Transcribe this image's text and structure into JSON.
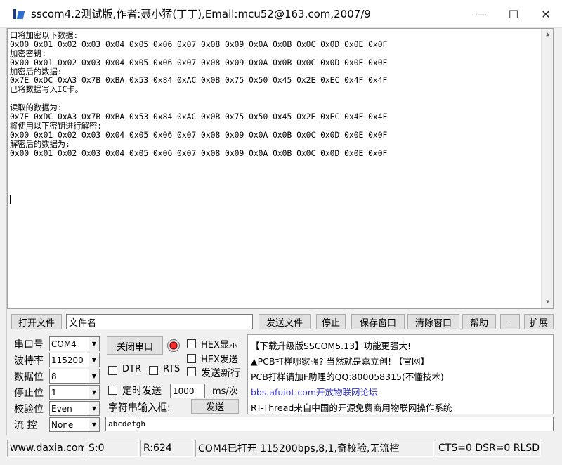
{
  "window": {
    "title": "sscom4.2测试版,作者:聂小猛(丁丁),Email:mcu52@163.com,2007/9",
    "minimize": "—",
    "maximize": "☐",
    "close": "✕"
  },
  "receive_lines": [
    "口将加密以下数据:",
    "0x00 0x01 0x02 0x03 0x04 0x05 0x06 0x07 0x08 0x09 0x0A 0x0B 0x0C 0x0D 0x0E 0x0F",
    "加密密钥:",
    "0x00 0x01 0x02 0x03 0x04 0x05 0x06 0x07 0x08 0x09 0x0A 0x0B 0x0C 0x0D 0x0E 0x0F",
    "加密后的数据:",
    "0x7E 0xDC 0xA3 0x7B 0xBA 0x53 0x84 0xAC 0x0B 0x75 0x50 0x45 0x2E 0xEC 0x4F 0x4F",
    "已将数据写入IC卡。",
    "",
    "读取的数据为:",
    "0x7E 0xDC 0xA3 0x7B 0xBA 0x53 0x84 0xAC 0x0B 0x75 0x50 0x45 0x2E 0xEC 0x4F 0x4F",
    "将使用以下密钥进行解密:",
    "0x00 0x01 0x02 0x03 0x04 0x05 0x06 0x07 0x08 0x09 0x0A 0x0B 0x0C 0x0D 0x0E 0x0F",
    "解密后的数据为:",
    "0x00 0x01 0x02 0x03 0x04 0x05 0x06 0x07 0x08 0x09 0x0A 0x0B 0x0C 0x0D 0x0E 0x0F"
  ],
  "toolbar": {
    "open_file": "打开文件",
    "file_name": "文件名",
    "send_file": "发送文件",
    "stop": "停止",
    "save_window": "保存窗口",
    "clear_window": "清除窗口",
    "help": "帮助",
    "minus": "-",
    "expand": "扩展"
  },
  "serial": {
    "port_label": "串口号",
    "port_value": "COM4",
    "baud_label": "波特率",
    "baud_value": "115200",
    "databits_label": "数据位",
    "databits_value": "8",
    "stopbits_label": "停止位",
    "stopbits_value": "1",
    "parity_label": "校验位",
    "parity_value": "Even",
    "flow_label": "流 控",
    "flow_value": "None"
  },
  "controls": {
    "close_port": "关闭串口",
    "hex_display": "HEX显示",
    "hex_send": "HEX发送",
    "dtr": "DTR",
    "rts": "RTS",
    "send_newline": "发送新行",
    "timed_send": "定时发送",
    "interval_value": "1000",
    "interval_unit": "ms/次",
    "input_label": "字符串输入框:",
    "send_button": "发送",
    "send_text": "abcdefgh"
  },
  "info": {
    "line1": "【下载升级版SSCOM5.13】功能更强大!",
    "line2": "▲PCB打样哪家强? 当然就是嘉立创! 【官网】",
    "line3": "PCB打样请加F助理的QQ:800058315(不懂技术)",
    "line4": "bbs.afuiot.com开放物联网论坛",
    "line5": "RT-Thread来自中国的开源免费商用物联网操作系统"
  },
  "status": {
    "website": "www.daxia.com",
    "sent": "S:0",
    "received": "R:624",
    "port_state": "COM4已打开  115200bps,8,1,奇校验,无流控",
    "lines": "CTS=0 DSR=0 RLSD"
  },
  "colors": {
    "link": "#3333cc",
    "indicator": "#ff2a2a"
  }
}
